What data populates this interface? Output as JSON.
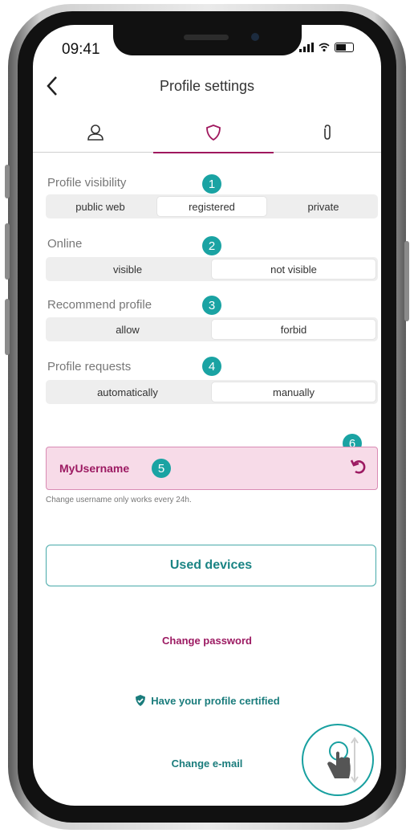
{
  "status_bar": {
    "time": "09:41"
  },
  "header": {
    "title": "Profile settings"
  },
  "tabs": [
    {
      "icon": "user-icon",
      "active": false
    },
    {
      "icon": "shield-icon",
      "active": true
    },
    {
      "icon": "paperclip-icon",
      "active": false
    }
  ],
  "settings": {
    "visibility": {
      "label": "Profile visibility",
      "options": [
        "public web",
        "registered",
        "private"
      ],
      "selected": "registered",
      "badge": "1"
    },
    "online": {
      "label": "Online",
      "options": [
        "visible",
        "not visible"
      ],
      "selected": "not visible",
      "badge": "2"
    },
    "recommend": {
      "label": "Recommend profile",
      "options": [
        "allow",
        "forbid"
      ],
      "selected": "forbid",
      "badge": "3"
    },
    "requests": {
      "label": "Profile requests",
      "options": [
        "automatically",
        "manually"
      ],
      "selected": "manually",
      "badge": "4"
    }
  },
  "username": {
    "value": "MyUsername",
    "badge": "5",
    "reset_badge": "6",
    "hint": "Change username only works every 24h."
  },
  "actions": {
    "used_devices": "Used devices",
    "change_password": "Change password",
    "certify": "Have your profile certified",
    "change_email": "Change e-mail"
  },
  "colors": {
    "accent": "#9c1a62",
    "teal": "#1aa3a3",
    "username_bg": "#f7dbe8"
  }
}
